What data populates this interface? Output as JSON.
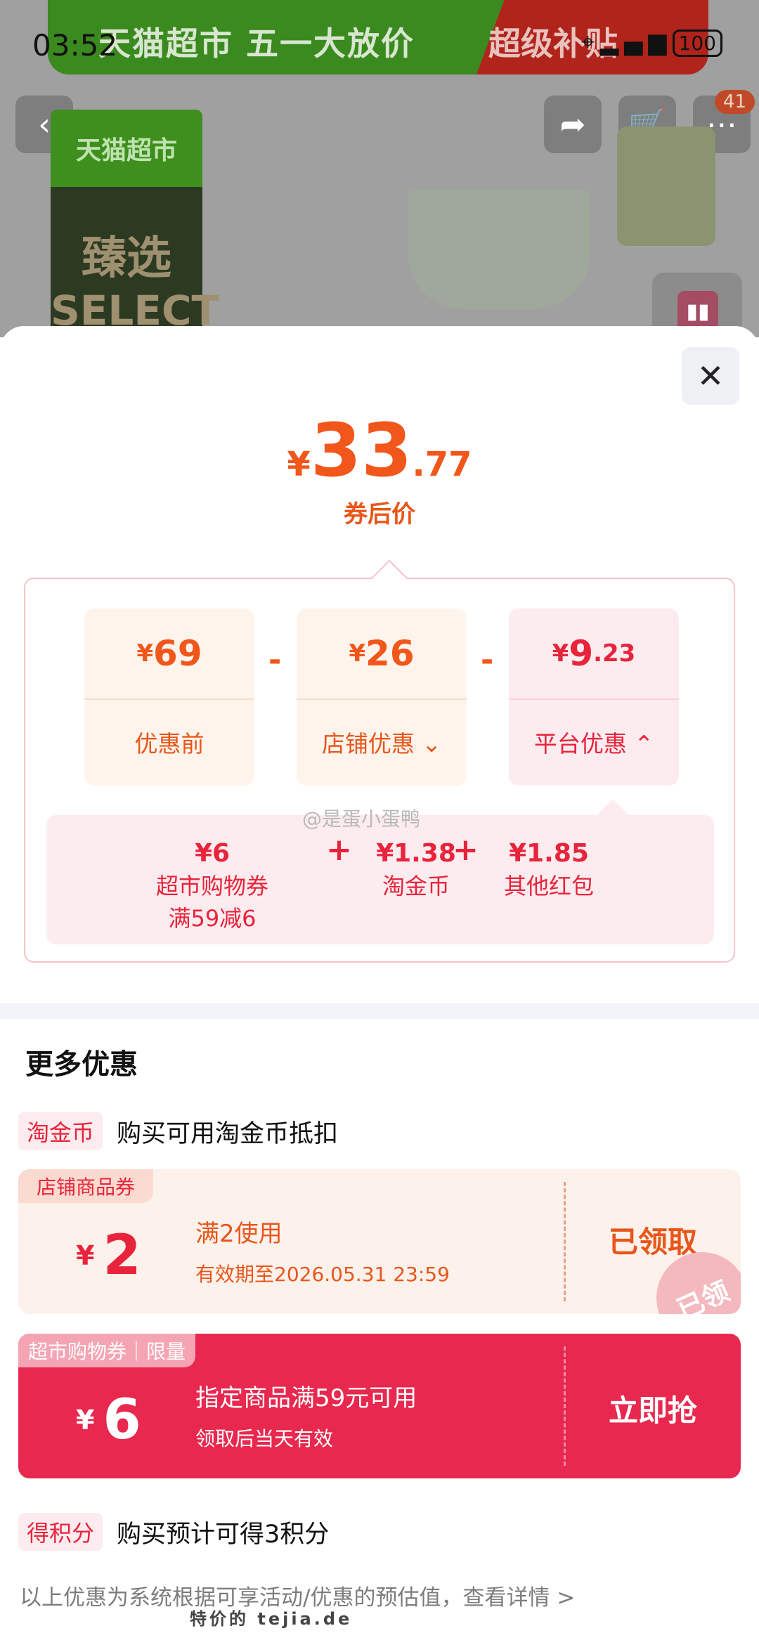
{
  "status": {
    "time": "03:52",
    "battery": "100"
  },
  "banner": {
    "left_text": "天猫超市 五一大放价",
    "right_text": "超级补贴"
  },
  "nav": {
    "cart_badge": "41"
  },
  "logo": {
    "line1": "天猫超市",
    "line2": "臻选",
    "line3": "SELECT"
  },
  "price": {
    "yen": "¥",
    "integer": "33",
    "decimal": ".77",
    "label": "券后价"
  },
  "breakdown": {
    "cards": [
      {
        "yen": "¥",
        "value": "69",
        "decimal": "",
        "label": "优惠前"
      },
      {
        "yen": "¥",
        "value": "26",
        "decimal": "",
        "label": "店铺优惠 ⌄"
      },
      {
        "yen": "¥",
        "value": "9",
        "decimal": ".23",
        "label": "平台优惠 ⌃"
      }
    ],
    "operator": "-",
    "platform_items": [
      {
        "value": "¥6",
        "label": "超市购物券",
        "note": "满59减6"
      },
      {
        "value": "¥1.38",
        "label": "淘金币",
        "note": ""
      },
      {
        "value": "¥1.85",
        "label": "其他红包",
        "note": ""
      }
    ],
    "plus": "+"
  },
  "watermark": "@是蛋小蛋鸭",
  "more": {
    "title": "更多优惠",
    "coin": {
      "tag": "淘金币",
      "text": "购买可用淘金币抵扣"
    },
    "coupons": [
      {
        "tag": "店铺商品券",
        "yen": "¥",
        "amount": "2",
        "main": "满2使用",
        "sub": "有效期至2026.05.31 23:59",
        "action": "已领取",
        "stamp": "已领"
      },
      {
        "tag": "超市购物券｜限量",
        "yen": "¥",
        "amount": "6",
        "main": "指定商品满59元可用",
        "sub": "领取后当天有效",
        "action": "立即抢"
      }
    ],
    "points": {
      "tag": "得积分",
      "text": "购买预计可得3积分"
    }
  },
  "footer": "以上优惠为系统根据可享活动/优惠的预估值，查看详情 >",
  "footer_watermark": "特价的 tejia.de"
}
